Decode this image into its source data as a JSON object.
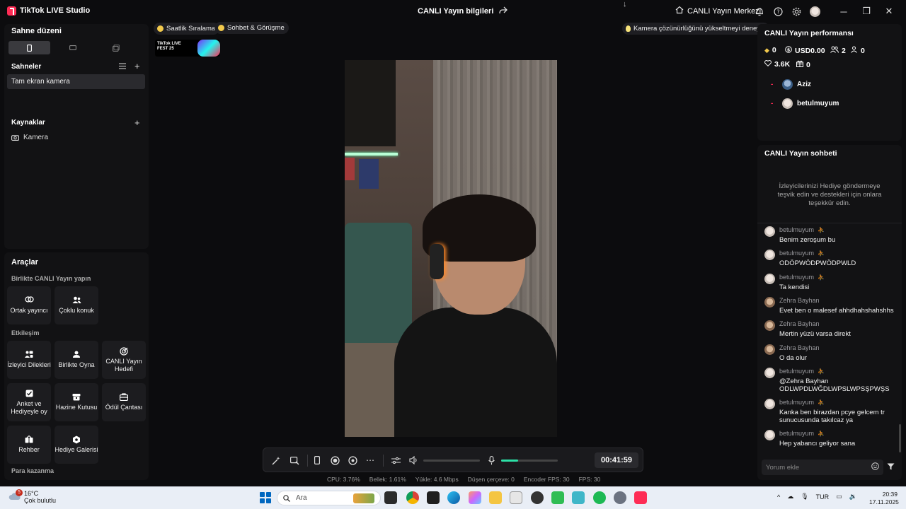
{
  "window": {
    "app_title": "TikTok LIVE Studio",
    "stream_info": "CANLI Yayın bilgileri",
    "live_center": "CANLI Yayın Merkezi"
  },
  "left": {
    "scene_layout_title": "Sahne düzeni",
    "scenes_title": "Sahneler",
    "scene_item": "Tam ekran kamera",
    "sources_title": "Kaynaklar",
    "source_item": "Kamera",
    "tools_title": "Araçlar",
    "section_collab": "Birlikte CANLI Yayın yapın",
    "tool_cohost": "Ortak yayıncı",
    "tool_multiguest": "Çoklu konuk",
    "section_engage": "Etkileşim",
    "tool_requests": "İzleyici Dilekleri",
    "tool_playtogether": "Birlikte Oyna",
    "tool_goal": "CANLI Yayın Hedefi",
    "tool_poll": "Anket ve Hediyeyle oy",
    "tool_treasure": "Hazine Kutusu",
    "tool_rewardbag": "Ödül Çantası",
    "tool_guide": "Rehber",
    "tool_gallery": "Hediye Galerisi",
    "section_earn": "Para kazanma"
  },
  "center": {
    "chip_hourly": "Saatlik Sıralama",
    "chip_chat": "Sohbet & Görüşme",
    "chip_camera_tip": "Kamera çözünürlüğünü yükseltmeyi deneyin",
    "livefest_text": "TikTok LIVE FEST 25",
    "timer": "00:41:59",
    "volume_level": 0.0,
    "mic_level": 0.3,
    "stats": {
      "cpu": "CPU:  3.76%",
      "memory": "Bellek:  1.61%",
      "upload": "Yükle:  4.6 Mbps",
      "dropped": "Düşen çerçeve:  0",
      "encoder_fps": "Encoder FPS:  30",
      "fps": "FPS:  30"
    }
  },
  "right": {
    "perf_title": "CANLI Yayın performansı",
    "diamonds": "0",
    "usd": "USD0.00",
    "viewers": "2",
    "new_followers": "0",
    "likes": "3.6K",
    "gifts": "0",
    "viewer1": "Aziz",
    "viewer2": "betulmuyum",
    "chat_title": "CANLI Yayın sohbeti",
    "chat_hint": "İzleyicilerinizi Hediye göndermeye teşvik edin ve destekleri için onlara teşekkür edin.",
    "messages": [
      {
        "name": "betulmuyum",
        "text": "Benim zeroşum bu"
      },
      {
        "name": "betulmuyum",
        "text": "ODÖPWÖDPWÖDPWLD"
      },
      {
        "name": "betulmuyum",
        "text": "Ta kendisi"
      },
      {
        "name": "Zehra Bayhan",
        "text": "Evet ben o malesef ahhdhahshahshhs"
      },
      {
        "name": "Zehra Bayhan",
        "text": "Mertin yüzü varsa direkt"
      },
      {
        "name": "Zehra Bayhan",
        "text": "O da olur"
      },
      {
        "name": "betulmuyum",
        "text": "@Zehra Bayhan ODLWPDLWĞDLWPSLWPSŞPWŞS"
      },
      {
        "name": "betulmuyum",
        "text": "Kanka ben birazdan pcye gelcem tr sunucusunda takılcaz ya"
      },
      {
        "name": "betulmuyum",
        "text": "Hep yabancı geliyor sana"
      }
    ],
    "comment_placeholder": "Yorum ekle"
  },
  "taskbar": {
    "weather_temp": "16°C",
    "weather_desc": "Çok bulutlu",
    "weather_badge": "5",
    "search_placeholder": "Ara",
    "language": "TUR",
    "time": "20:39",
    "date": "17.11.2025"
  }
}
